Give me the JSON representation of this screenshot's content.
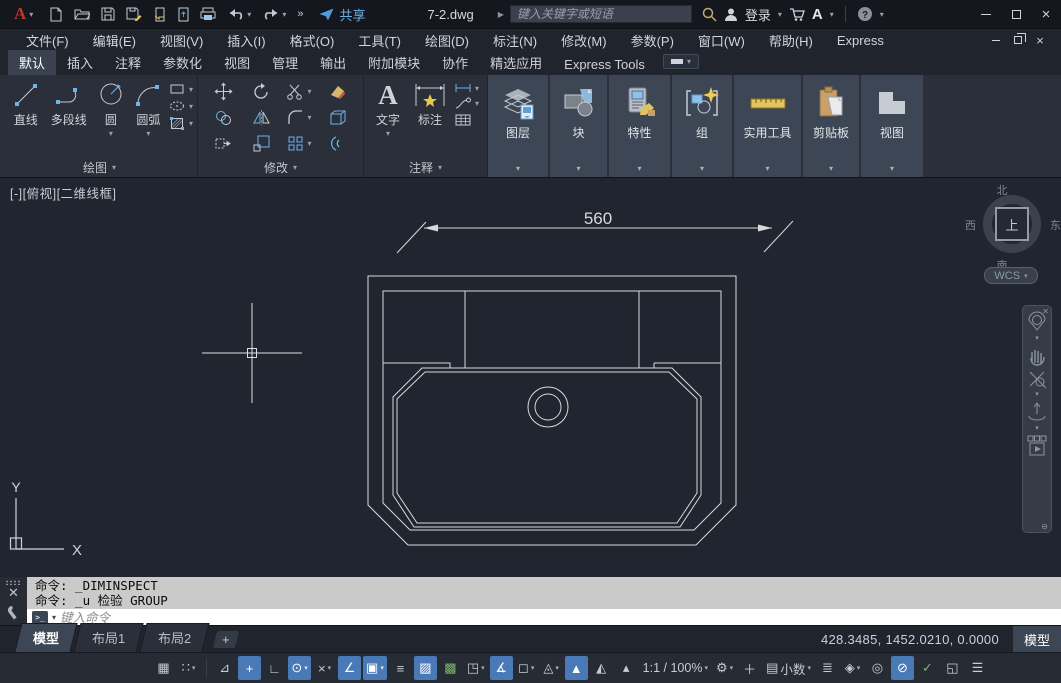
{
  "titlebar": {
    "share_label": "共享",
    "filename": "7-2.dwg",
    "search_placeholder": "键入关键字或短语",
    "signin_label": "登录",
    "store_label": "A"
  },
  "menubar": {
    "items": [
      {
        "name": "menu-file",
        "label": "文件(F)"
      },
      {
        "name": "menu-edit",
        "label": "编辑(E)"
      },
      {
        "name": "menu-view",
        "label": "视图(V)"
      },
      {
        "name": "menu-insert",
        "label": "插入(I)"
      },
      {
        "name": "menu-format",
        "label": "格式(O)"
      },
      {
        "name": "menu-tools",
        "label": "工具(T)"
      },
      {
        "name": "menu-draw",
        "label": "绘图(D)"
      },
      {
        "name": "menu-dimension",
        "label": "标注(N)"
      },
      {
        "name": "menu-modify",
        "label": "修改(M)"
      },
      {
        "name": "menu-parametric",
        "label": "参数(P)"
      },
      {
        "name": "menu-window",
        "label": "窗口(W)"
      },
      {
        "name": "menu-help",
        "label": "帮助(H)"
      },
      {
        "name": "menu-express",
        "label": "Express"
      }
    ]
  },
  "ribbon": {
    "tabs": [
      {
        "name": "tab-home",
        "label": "默认",
        "active": true
      },
      {
        "name": "tab-insert",
        "label": "插入"
      },
      {
        "name": "tab-annotate",
        "label": "注释"
      },
      {
        "name": "tab-parametric",
        "label": "参数化"
      },
      {
        "name": "tab-view",
        "label": "视图"
      },
      {
        "name": "tab-manage",
        "label": "管理"
      },
      {
        "name": "tab-output",
        "label": "输出"
      },
      {
        "name": "tab-addins",
        "label": "附加模块"
      },
      {
        "name": "tab-collaborate",
        "label": "协作"
      },
      {
        "name": "tab-featured",
        "label": "精选应用"
      },
      {
        "name": "tab-express",
        "label": "Express Tools"
      }
    ],
    "draw": {
      "label": "绘图",
      "line": "直线",
      "polyline": "多段线",
      "circle": "圆",
      "arc": "圆弧"
    },
    "modify": {
      "label": "修改"
    },
    "annotate": {
      "label": "注释",
      "text": "文字",
      "dim": "标注"
    },
    "layers_label": "图层",
    "block_label": "块",
    "properties_label": "特性",
    "groups_label": "组",
    "utilities_label": "实用工具",
    "clipboard_label": "剪贴板",
    "view_label": "视图"
  },
  "viewport": {
    "vp_control": "[-]",
    "view_control": "[俯视]",
    "style_control": "[二维线框]",
    "viewcube": {
      "north": "北",
      "south": "南",
      "west": "西",
      "east": "东",
      "top": "上",
      "wcs": "WCS"
    },
    "ucs": {
      "x": "X",
      "y": "Y"
    }
  },
  "drawing": {
    "dimension_label": "560"
  },
  "commandline": {
    "history": [
      "命令: _DIMINSPECT",
      "命令: _u 检验 GROUP"
    ],
    "input_placeholder": "键入命令"
  },
  "layoutbar": {
    "tabs": [
      {
        "name": "layout-tab-model",
        "label": "模型",
        "active": true
      },
      {
        "name": "layout-tab-layout1",
        "label": "布局1"
      },
      {
        "name": "layout-tab-layout2",
        "label": "布局2"
      }
    ],
    "add_label": "+",
    "coordinates": "428.3485, 1452.0210, 0.0000",
    "model_button": "模型"
  },
  "statusbar": {
    "icons": [
      {
        "name": "grid-display-icon",
        "glyph": "▦"
      },
      {
        "name": "snap-mode-icon",
        "glyph": "∷",
        "caret": "▾"
      },
      {
        "sep": true
      },
      {
        "name": "infer-constraints-icon",
        "glyph": "⊿"
      },
      {
        "name": "dynamic-input-icon",
        "glyph": "+",
        "active": true
      },
      {
        "name": "ortho-mode-icon",
        "glyph": "∟"
      },
      {
        "name": "polar-tracking-icon",
        "glyph": "⊙",
        "active": true,
        "caret": "▾"
      },
      {
        "name": "isometric-drafting-icon",
        "glyph": "×",
        "caret": "▾"
      },
      {
        "name": "object-snap-tracking-icon",
        "glyph": "∠",
        "active": true
      },
      {
        "name": "object-snap-icon",
        "glyph": "▣",
        "active": true,
        "caret": "▾"
      },
      {
        "name": "lineweight-icon",
        "glyph": "≡"
      },
      {
        "name": "transparency-icon",
        "glyph": "▨",
        "active": true
      },
      {
        "name": "selection-cycling-icon",
        "glyph": "▩",
        "green": true
      },
      {
        "name": "3d-object-snap-icon",
        "glyph": "◳",
        "caret": "▾"
      },
      {
        "name": "dynamic-ucs-icon",
        "glyph": "∡",
        "active": true
      },
      {
        "name": "selection-filtering-icon",
        "glyph": "◻",
        "caret": "▾"
      },
      {
        "name": "gizmo-icon",
        "glyph": "◬",
        "caret": "▾"
      },
      {
        "name": "annotation-visibility-icon",
        "glyph": "▲",
        "active": true
      },
      {
        "name": "annotation-autoscale-icon",
        "glyph": "◭"
      },
      {
        "name": "annotation-scale-flag-icon",
        "glyph": "▴"
      },
      {
        "name": "annotation-scale-value",
        "text": "1:1 / 100%",
        "caret": "▾"
      },
      {
        "name": "workspace-switching-icon",
        "glyph": "⚙",
        "caret": "▾"
      },
      {
        "name": "annotation-monitor-icon",
        "glyph": "＋"
      },
      {
        "name": "units-control",
        "glyph": "▤",
        "text": "小数",
        "caret": "▾"
      },
      {
        "name": "quick-properties-icon",
        "glyph": "≣"
      },
      {
        "name": "lock-ui-icon",
        "glyph": "◈",
        "caret": "▾"
      },
      {
        "name": "isolate-objects-icon",
        "glyph": "◎"
      },
      {
        "name": "graphics-performance-icon",
        "glyph": "⊘",
        "active": true
      },
      {
        "name": "trusted-dwg-icon",
        "glyph": "✓",
        "green": true
      },
      {
        "name": "clean-screen-icon",
        "glyph": "◱"
      },
      {
        "name": "customization-icon",
        "glyph": "☰"
      }
    ]
  }
}
